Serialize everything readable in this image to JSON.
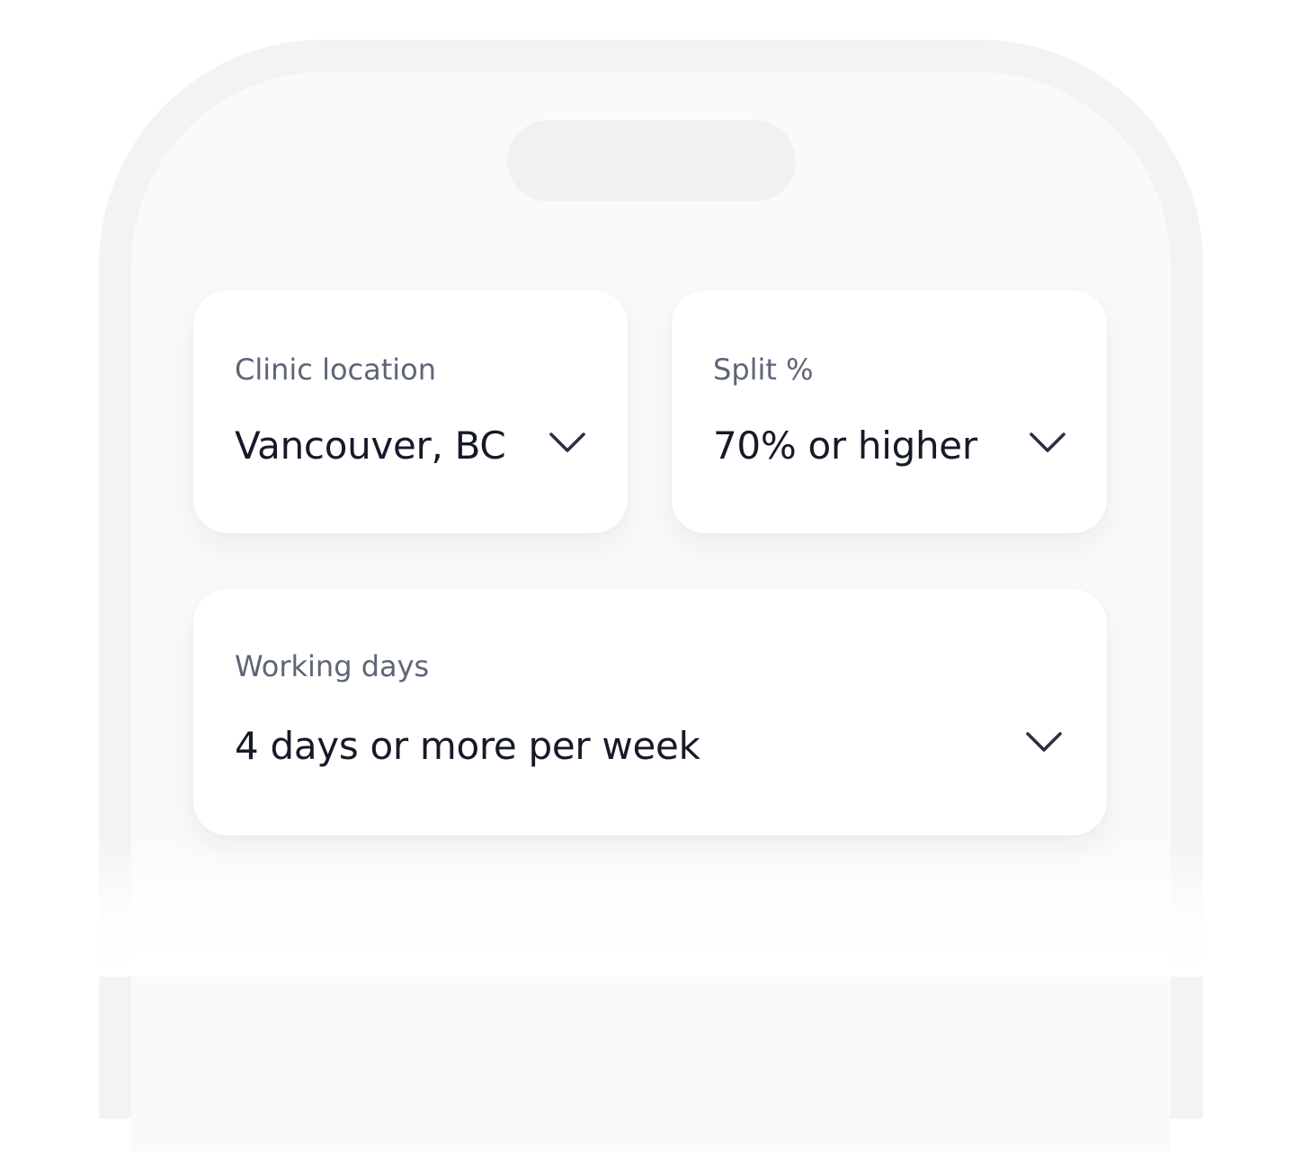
{
  "filters": {
    "clinic_location": {
      "label": "Clinic location",
      "selected": "Vancouver, BC",
      "icon": "chevron-down-icon"
    },
    "split": {
      "label": "Split %",
      "selected": "70% or higher",
      "icon": "chevron-down-icon"
    },
    "working_days": {
      "label": "Working days",
      "selected": "4 days or more per week",
      "icon": "chevron-down-icon"
    }
  },
  "colors": {
    "label_text": "#5e6577",
    "value_text": "#161a28",
    "chevron": "#2a3042",
    "card_background": "#ffffff",
    "screen_background": "#fafafb",
    "frame_background": "#f3f3f4"
  }
}
